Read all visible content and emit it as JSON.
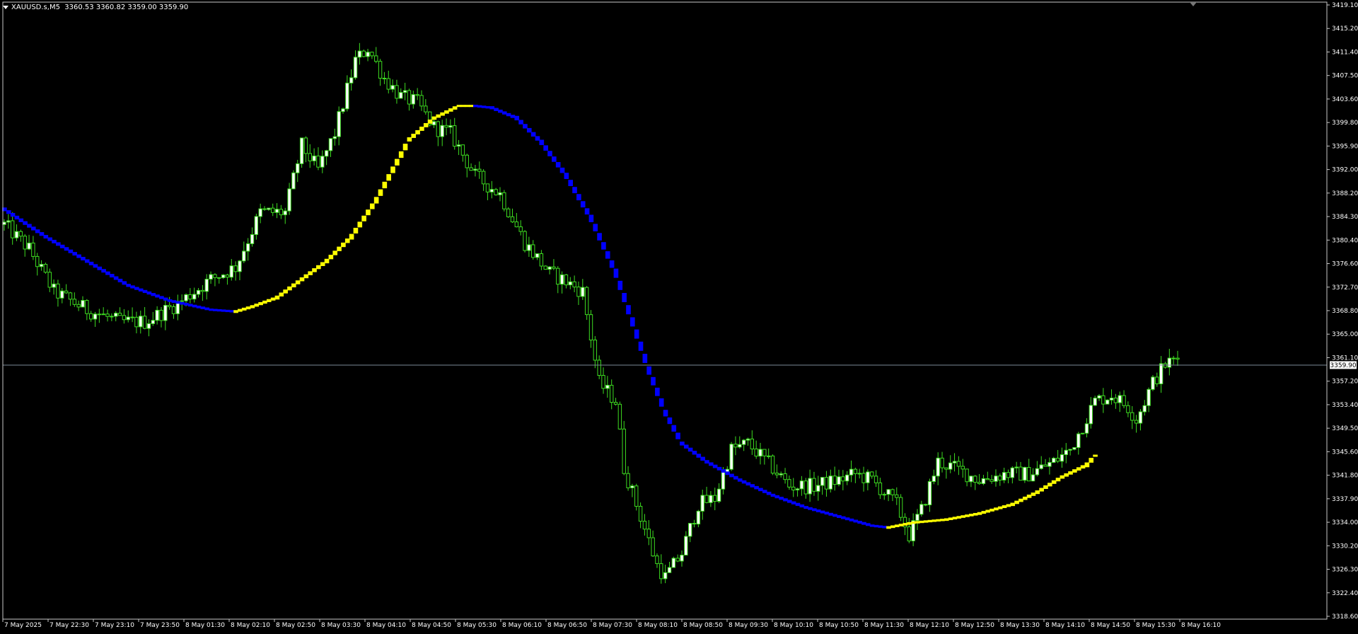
{
  "header": {
    "symbol": "XAUUSD.s,M5",
    "ohlc": "3360.53 3360.82 3359.00 3359.90"
  },
  "colors": {
    "background": "#000000",
    "frame": "#c8c8c8",
    "bull_candle": "#ffffff",
    "candle_outline": "#3ddc20",
    "ma_up": "#ffff00",
    "ma_down": "#0000ff",
    "price_line": "#7d8a99",
    "axis_text": "#ffffff"
  },
  "chart_data": {
    "type": "candlestick",
    "symbol": "XAUUSD.s",
    "timeframe": "M5",
    "current_price": 3359.9,
    "current_price_label": "3359.90",
    "ylim": [
      3318.6,
      3419.1
    ],
    "y_ticks": [
      "3419.10",
      "3415.20",
      "3411.40",
      "3407.50",
      "3403.60",
      "3399.80",
      "3395.90",
      "3392.00",
      "3388.20",
      "3384.30",
      "3380.40",
      "3376.60",
      "3372.70",
      "3368.80",
      "3365.00",
      "3361.10",
      "3357.20",
      "3353.40",
      "3349.50",
      "3345.60",
      "3341.80",
      "3337.90",
      "3334.00",
      "3330.20",
      "3326.30",
      "3322.40",
      "3318.60"
    ],
    "x_ticks": [
      "7 May 2025",
      "7 May 22:30",
      "7 May 23:10",
      "7 May 23:50",
      "8 May 01:30",
      "8 May 02:10",
      "8 May 02:50",
      "8 May 03:30",
      "8 May 04:10",
      "8 May 04:50",
      "8 May 05:30",
      "8 May 06:10",
      "8 May 06:50",
      "8 May 07:30",
      "8 May 08:10",
      "8 May 08:50",
      "8 May 09:30",
      "8 May 10:10",
      "8 May 10:50",
      "8 May 11:30",
      "8 May 12:10",
      "8 May 12:50",
      "8 May 13:30",
      "8 May 14:10",
      "8 May 14:50",
      "8 May 15:30",
      "8 May 16:10"
    ],
    "price_path": [
      [
        0,
        3383
      ],
      [
        6,
        3379
      ],
      [
        12,
        3372
      ],
      [
        20,
        3369
      ],
      [
        28,
        3367
      ],
      [
        34,
        3367
      ],
      [
        42,
        3370
      ],
      [
        50,
        3374
      ],
      [
        56,
        3376
      ],
      [
        62,
        3385
      ],
      [
        68,
        3385
      ],
      [
        72,
        3396
      ],
      [
        76,
        3392
      ],
      [
        80,
        3398
      ],
      [
        85,
        3410
      ],
      [
        88,
        3412
      ],
      [
        92,
        3407
      ],
      [
        96,
        3404
      ],
      [
        100,
        3403
      ],
      [
        104,
        3399
      ],
      [
        108,
        3398
      ],
      [
        114,
        3391
      ],
      [
        120,
        3388
      ],
      [
        126,
        3380
      ],
      [
        132,
        3375
      ],
      [
        135,
        3374
      ],
      [
        140,
        3372
      ],
      [
        144,
        3357
      ],
      [
        148,
        3354
      ],
      [
        150,
        3343
      ],
      [
        154,
        3335
      ],
      [
        158,
        3327
      ],
      [
        160,
        3325
      ],
      [
        164,
        3329
      ],
      [
        168,
        3337
      ],
      [
        172,
        3338
      ],
      [
        176,
        3346
      ],
      [
        180,
        3347
      ],
      [
        186,
        3343
      ],
      [
        190,
        3340
      ],
      [
        196,
        3340
      ],
      [
        202,
        3341
      ],
      [
        206,
        3342
      ],
      [
        210,
        3341
      ],
      [
        216,
        3337
      ],
      [
        219,
        3332
      ],
      [
        222,
        3336
      ],
      [
        226,
        3344
      ],
      [
        230,
        3343
      ],
      [
        236,
        3341
      ],
      [
        242,
        3342
      ],
      [
        248,
        3342
      ],
      [
        254,
        3344
      ],
      [
        258,
        3346
      ],
      [
        264,
        3354
      ],
      [
        268,
        3355
      ],
      [
        272,
        3353
      ],
      [
        274,
        3351
      ],
      [
        278,
        3357
      ],
      [
        281,
        3360
      ],
      [
        284,
        3361
      ]
    ],
    "ma_path": [
      [
        0,
        3385.5
      ],
      [
        10,
        3381
      ],
      [
        20,
        3377
      ],
      [
        30,
        3373
      ],
      [
        40,
        3370.5
      ],
      [
        50,
        3369
      ],
      [
        56,
        3368.7
      ],
      [
        60,
        3369.5
      ],
      [
        66,
        3371
      ],
      [
        72,
        3374
      ],
      [
        78,
        3377
      ],
      [
        84,
        3381
      ],
      [
        90,
        3387
      ],
      [
        94,
        3392
      ],
      [
        98,
        3397
      ],
      [
        104,
        3400.5
      ],
      [
        110,
        3402.5
      ],
      [
        114,
        3402.5
      ],
      [
        118,
        3402.2
      ],
      [
        124,
        3400.5
      ],
      [
        130,
        3396.5
      ],
      [
        136,
        3391
      ],
      [
        142,
        3384
      ],
      [
        148,
        3375
      ],
      [
        152,
        3367
      ],
      [
        156,
        3359
      ],
      [
        160,
        3352
      ],
      [
        164,
        3347
      ],
      [
        170,
        3344
      ],
      [
        178,
        3341
      ],
      [
        186,
        3338.5
      ],
      [
        194,
        3336.5
      ],
      [
        202,
        3335
      ],
      [
        210,
        3333.5
      ],
      [
        214,
        3333.2
      ],
      [
        220,
        3334
      ],
      [
        228,
        3334.5
      ],
      [
        236,
        3335.5
      ],
      [
        244,
        3337
      ],
      [
        250,
        3339
      ],
      [
        256,
        3341.5
      ],
      [
        262,
        3343.5
      ],
      [
        264,
        3345
      ]
    ],
    "ma_turns": [
      [
        0,
        56,
        "down"
      ],
      [
        56,
        114,
        "up"
      ],
      [
        114,
        214,
        "down"
      ],
      [
        214,
        264,
        "up"
      ]
    ],
    "candle_count": 285,
    "grid": false
  }
}
